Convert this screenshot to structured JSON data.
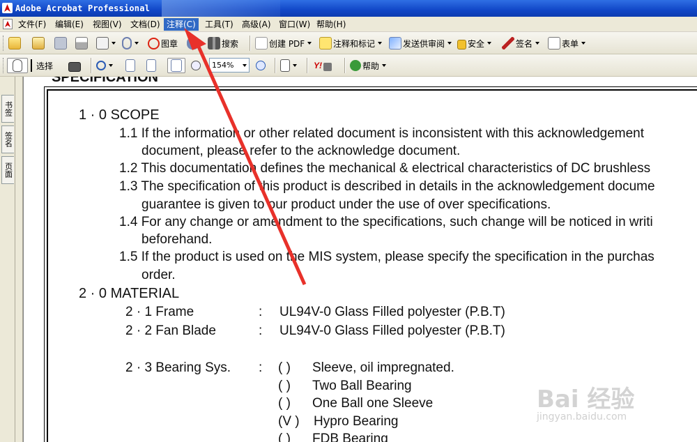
{
  "window": {
    "title": "Adobe Acrobat Professional"
  },
  "menu": {
    "items": [
      "文件(F)",
      "编辑(E)",
      "视图(V)",
      "文档(D)",
      "注释(C)",
      "工具(T)",
      "高级(A)",
      "窗口(W)",
      "帮助(H)"
    ],
    "active": "注释(C)"
  },
  "toolbar1": {
    "stamp": "图章",
    "search": "搜索",
    "create_pdf": "创建 PDF",
    "comment_markup": "注释和标记",
    "send_review": "发送供审阅",
    "security": "安全",
    "sign": "签名",
    "forms": "表单"
  },
  "toolbar2": {
    "select": "选择",
    "zoom": "154%",
    "help": "帮助",
    "yahoo": "Y!"
  },
  "side_tabs": [
    "书签",
    "签名",
    "页面"
  ],
  "document": {
    "cut_heading": "SPECIFICATION",
    "s1_title": "1 · 0   SCOPE",
    "s1_1a": "1.1  If the information or other related document is inconsistent with this acknowledgement",
    "s1_1b": "document, please refer to the acknowledge document.",
    "s1_2": "1.2  This  documentation defines the mechanical & electrical characteristics of DC brushless",
    "s1_3a": "1.3  The specification of this product is described in details in the acknowledgement docume",
    "s1_3b": "guarantee is given to our product under the use of over specifications.",
    "s1_4a": "1.4  For any change or amendment to the specifications, such change will be noticed in writi",
    "s1_4b": "beforehand.",
    "s1_5a": "1.5  If the product is used on the MIS system, please specify the specification in the purchas",
    "s1_5b": "order.",
    "s2_title": "2 · 0   MATERIAL",
    "s2_1_label": "2 · 1   Frame",
    "s2_1_value": "UL94V-0  Glass  Filled  polyester  (P.B.T)",
    "s2_2_label": "2 · 2   Fan  Blade",
    "s2_2_value": "UL94V-0  Glass  Filled  polyester  (P.B.T)",
    "s2_3_label": "2 · 3   Bearing  Sys.",
    "colon": ":",
    "bearing_options": [
      {
        "mark": "(   )",
        "text": "Sleeve, oil  impregnated."
      },
      {
        "mark": "(   )",
        "text": "Two  Ball  Bearing"
      },
      {
        "mark": "(   )",
        "text": "One  Ball  one  Sleeve"
      },
      {
        "mark": "(V )",
        "text": "Hypro  Bearing"
      },
      {
        "mark": "(   )",
        "text": "FDB Bearing"
      }
    ]
  },
  "watermark": {
    "brand": "Bai 经验",
    "url": "jingyan.baidu.com"
  },
  "annotation": {
    "arrow_color": "#e8312a"
  }
}
